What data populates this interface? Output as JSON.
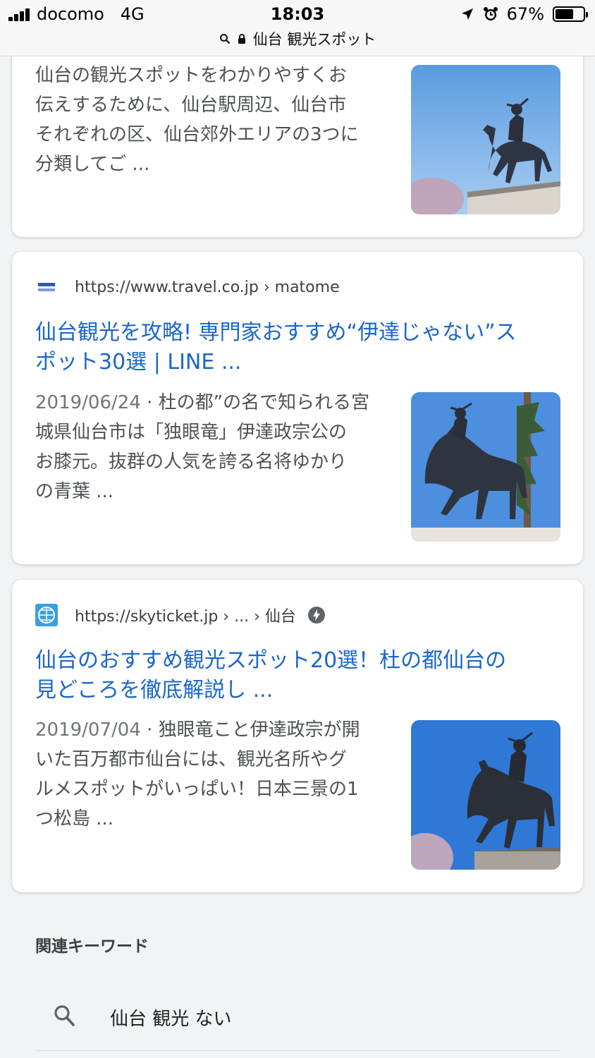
{
  "status_bar": {
    "carrier": "docomo",
    "network": "4G",
    "time": "18:03",
    "battery": "67%",
    "battery_level": 0.67
  },
  "url_bar": {
    "query": "仙台 観光スポット"
  },
  "results": [
    {
      "snippet_lines": [
        "仙台の観光スポットをわかりやすくお",
        "伝えするために、仙台駅周辺、仙台市",
        "それぞれの区、仙台郊外エリアの3つに",
        "分類してご ..."
      ]
    },
    {
      "url": "https://www.travel.co.jp › matome",
      "title_lines": [
        "仙台観光を攻略! 専門家おすすめ“伊達じゃない”ス",
        "ポット30選 | LINE ..."
      ],
      "date": "2019/06/24",
      "snippet_lines": [
        "杜の都”の名で知られる宮",
        "城県仙台市は「独眼竜」伊達政宗公の",
        "お膝元。抜群の人気を誇る名将ゆかり",
        "の青葉 ..."
      ]
    },
    {
      "url": "https://skyticket.jp › ... › 仙台",
      "title_lines": [
        "仙台のおすすめ観光スポット20選！杜の都仙台の",
        "見どころを徹底解説し ..."
      ],
      "date": "2019/07/04",
      "snippet_lines": [
        "独眼竜こと伊達政宗が開",
        "いた百万都市仙台には、観光名所やグ",
        "ルメスポットがいっぱい！日本三景の1",
        "つ松島 ..."
      ]
    }
  ],
  "related": {
    "heading": "関連キーワード",
    "items": [
      "仙台 観光 ない"
    ]
  },
  "colors": {
    "link": "#1a66cc",
    "snippet": "#4d5156",
    "sky": "#3f86d8"
  }
}
